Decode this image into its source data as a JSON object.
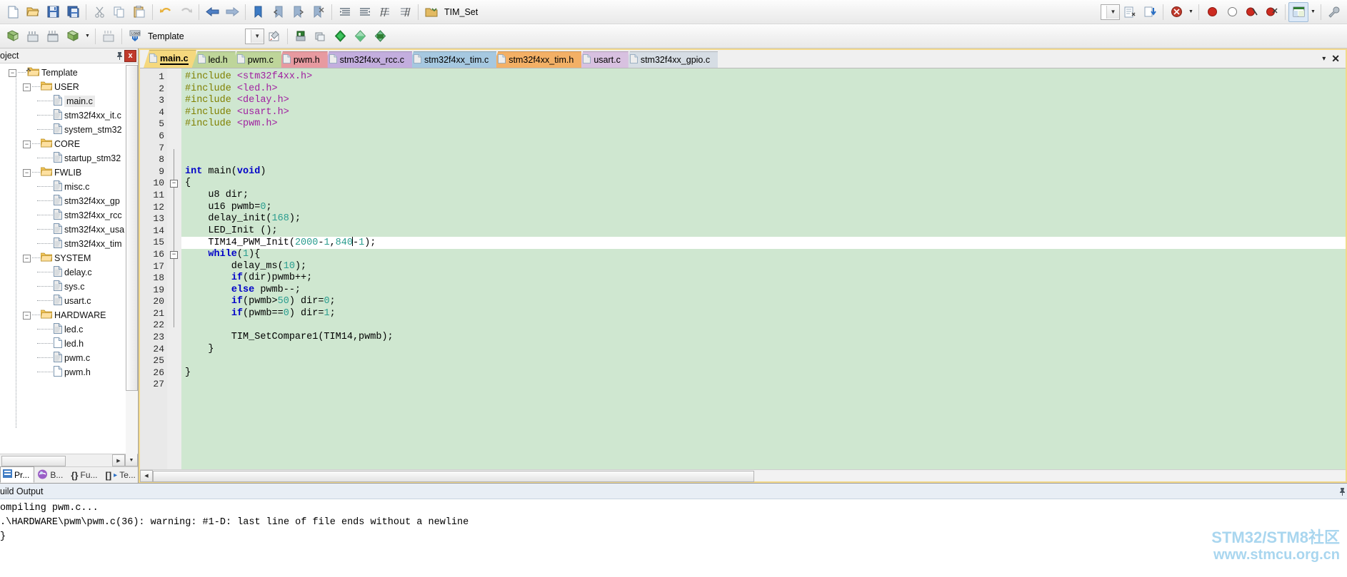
{
  "app": {
    "name": "Keil uVision",
    "target": "TIM_Set",
    "project_config": "Template"
  },
  "toolbar_main": {
    "buttons": [
      {
        "name": "new-file",
        "label": "New"
      },
      {
        "name": "open-file",
        "label": "Open"
      },
      {
        "name": "save-file",
        "label": "Save"
      },
      {
        "name": "save-all",
        "label": "Save All"
      },
      {
        "name": "cut",
        "label": "Cut"
      },
      {
        "name": "copy",
        "label": "Copy"
      },
      {
        "name": "paste",
        "label": "Paste"
      },
      {
        "name": "undo",
        "label": "Undo"
      },
      {
        "name": "redo",
        "label": "Redo"
      },
      {
        "name": "navigate-back",
        "label": "Back"
      },
      {
        "name": "navigate-forward",
        "label": "Forward"
      },
      {
        "name": "bookmark-toggle",
        "label": "Insert/Remove Bookmark"
      },
      {
        "name": "bookmark-prev",
        "label": "Go to Previous Bookmark"
      },
      {
        "name": "bookmark-next",
        "label": "Go to Next Bookmark"
      },
      {
        "name": "bookmark-clear",
        "label": "Clear All Bookmarks"
      },
      {
        "name": "indent-right",
        "label": "Indent Selected Text"
      },
      {
        "name": "indent-left",
        "label": "Unindent Selected Text"
      },
      {
        "name": "comment-block",
        "label": "Comment Selection"
      },
      {
        "name": "uncomment-block",
        "label": "Uncomment Selection"
      },
      {
        "name": "target-options",
        "label": "Target Options"
      }
    ],
    "target_value": "TIM_Set",
    "right_buttons": [
      {
        "name": "build-target",
        "label": "Build"
      },
      {
        "name": "download",
        "label": "Download"
      },
      {
        "name": "start-debug",
        "label": "Start/Stop Debug Session"
      },
      {
        "name": "insert-breakpoint",
        "label": "Insert/Remove Breakpoint"
      },
      {
        "name": "disable-breakpoint",
        "label": "Enable/Disable Breakpoint"
      },
      {
        "name": "disable-all-breakpoints",
        "label": "Disable All Breakpoints"
      },
      {
        "name": "kill-all-breakpoints",
        "label": "Kill All Breakpoints"
      },
      {
        "name": "window-layout",
        "label": "Window Layout"
      },
      {
        "name": "configuration",
        "label": "Configuration Wizard"
      }
    ]
  },
  "toolbar_build": {
    "buttons": [
      {
        "name": "translate-file",
        "label": "Translate Current File"
      },
      {
        "name": "build-target-2",
        "label": "Build Target"
      },
      {
        "name": "rebuild-all",
        "label": "Rebuild All Target Files"
      },
      {
        "name": "batch-build",
        "label": "Batch Build"
      },
      {
        "name": "stop-build",
        "label": "Stop Build"
      },
      {
        "name": "download-flash",
        "label": "Download To Flash"
      }
    ],
    "project_value": "Template",
    "right_buttons": [
      {
        "name": "manage-project-items",
        "label": "Manage Project Items"
      },
      {
        "name": "pack-installer",
        "label": "Pack Installer"
      },
      {
        "name": "run-to-main",
        "label": "Run"
      },
      {
        "name": "select-software-packs",
        "label": "Select Software Packs"
      },
      {
        "name": "manage-run-time",
        "label": "Manage Run-Time Environment"
      }
    ]
  },
  "project_panel": {
    "title": "oject",
    "pin_icon": "pin-icon",
    "close_label": "x",
    "tree": [
      {
        "label": "Template",
        "depth": 0,
        "type": "project",
        "expanded": true
      },
      {
        "label": "USER",
        "depth": 1,
        "type": "folder",
        "expanded": true
      },
      {
        "label": "main.c",
        "depth": 2,
        "type": "file-c",
        "selected": true
      },
      {
        "label": "stm32f4xx_it.c",
        "depth": 2,
        "type": "file-c"
      },
      {
        "label": "system_stm32",
        "depth": 2,
        "type": "file-c"
      },
      {
        "label": "CORE",
        "depth": 1,
        "type": "folder",
        "expanded": true
      },
      {
        "label": "startup_stm32",
        "depth": 2,
        "type": "file-c"
      },
      {
        "label": "FWLIB",
        "depth": 1,
        "type": "folder",
        "expanded": true
      },
      {
        "label": "misc.c",
        "depth": 2,
        "type": "file-c"
      },
      {
        "label": "stm32f4xx_gp",
        "depth": 2,
        "type": "file-c"
      },
      {
        "label": "stm32f4xx_rcc",
        "depth": 2,
        "type": "file-c"
      },
      {
        "label": "stm32f4xx_usa",
        "depth": 2,
        "type": "file-c"
      },
      {
        "label": "stm32f4xx_tim",
        "depth": 2,
        "type": "file-c"
      },
      {
        "label": "SYSTEM",
        "depth": 1,
        "type": "folder",
        "expanded": true
      },
      {
        "label": "delay.c",
        "depth": 2,
        "type": "file-c"
      },
      {
        "label": "sys.c",
        "depth": 2,
        "type": "file-c"
      },
      {
        "label": "usart.c",
        "depth": 2,
        "type": "file-c"
      },
      {
        "label": "HARDWARE",
        "depth": 1,
        "type": "folder",
        "expanded": true
      },
      {
        "label": "led.c",
        "depth": 2,
        "type": "file-c"
      },
      {
        "label": "led.h",
        "depth": 2,
        "type": "file-h"
      },
      {
        "label": "pwm.c",
        "depth": 2,
        "type": "file-c"
      },
      {
        "label": "pwm.h",
        "depth": 2,
        "type": "file-h"
      }
    ],
    "bottom_tabs": [
      {
        "label": "Pr...",
        "name": "tab-project",
        "active": true,
        "icon": "project-icon"
      },
      {
        "label": "B...",
        "name": "tab-books",
        "active": false,
        "icon": "books-icon"
      },
      {
        "label": "Fu...",
        "name": "tab-functions",
        "active": false,
        "icon": "braces-icon"
      },
      {
        "label": "Te...",
        "name": "tab-templates",
        "active": false,
        "icon": "templates-icon"
      }
    ]
  },
  "editor": {
    "tabs": [
      {
        "label": "main.c",
        "color": "#f5d87e",
        "active": true
      },
      {
        "label": "led.h",
        "color": "#bed59a",
        "active": false
      },
      {
        "label": "pwm.c",
        "color": "#bed59a",
        "active": false
      },
      {
        "label": "pwm.h",
        "color": "#e79aa0",
        "active": false
      },
      {
        "label": "stm32f4xx_rcc.c",
        "color": "#c3aede",
        "active": false
      },
      {
        "label": "stm32f4xx_tim.c",
        "color": "#a6c8e0",
        "active": false
      },
      {
        "label": "stm32f4xx_tim.h",
        "color": "#f3b066",
        "active": false
      },
      {
        "label": "usart.c",
        "color": "#d8c1e0",
        "active": false
      },
      {
        "label": "stm32f4xx_gpio.c",
        "color": "#d6dde4",
        "active": false
      }
    ],
    "tabbar_right": {
      "overflow": "▾",
      "close": "✕"
    },
    "code_lines": [
      {
        "n": 1,
        "tokens": [
          {
            "t": "#include ",
            "c": "pp"
          },
          {
            "t": "<stm32f4xx.h>",
            "c": "hdr"
          }
        ]
      },
      {
        "n": 2,
        "tokens": [
          {
            "t": "#include ",
            "c": "pp"
          },
          {
            "t": "<led.h>",
            "c": "hdr"
          }
        ]
      },
      {
        "n": 3,
        "tokens": [
          {
            "t": "#include ",
            "c": "pp"
          },
          {
            "t": "<delay.h>",
            "c": "hdr"
          }
        ]
      },
      {
        "n": 4,
        "tokens": [
          {
            "t": "#include ",
            "c": "pp"
          },
          {
            "t": "<usart.h>",
            "c": "hdr"
          }
        ]
      },
      {
        "n": 5,
        "tokens": [
          {
            "t": "#include ",
            "c": "pp"
          },
          {
            "t": "<pwm.h>",
            "c": "hdr"
          }
        ]
      },
      {
        "n": 6,
        "tokens": []
      },
      {
        "n": 7,
        "tokens": []
      },
      {
        "n": 8,
        "tokens": []
      },
      {
        "n": 9,
        "tokens": [
          {
            "t": "int ",
            "c": "k"
          },
          {
            "t": "main(",
            "c": "pl"
          },
          {
            "t": "void",
            "c": "k"
          },
          {
            "t": ")",
            "c": "pl"
          }
        ]
      },
      {
        "n": 10,
        "tokens": [
          {
            "t": "{",
            "c": "pl"
          }
        ],
        "fold": "minus"
      },
      {
        "n": 11,
        "tokens": [
          {
            "t": "    u8 dir;",
            "c": "pl"
          }
        ]
      },
      {
        "n": 12,
        "tokens": [
          {
            "t": "    u16 pwmb=",
            "c": "pl"
          },
          {
            "t": "0",
            "c": "num"
          },
          {
            "t": ";",
            "c": "pl"
          }
        ]
      },
      {
        "n": 13,
        "tokens": [
          {
            "t": "    delay_init(",
            "c": "pl"
          },
          {
            "t": "168",
            "c": "num"
          },
          {
            "t": ");",
            "c": "pl"
          }
        ]
      },
      {
        "n": 14,
        "tokens": [
          {
            "t": "    LED_Init ();",
            "c": "pl"
          }
        ]
      },
      {
        "n": 15,
        "tokens": [
          {
            "t": "    TIM14_PWM_Init(",
            "c": "pl"
          },
          {
            "t": "2000",
            "c": "num"
          },
          {
            "t": "-",
            "c": "pl"
          },
          {
            "t": "1",
            "c": "num"
          },
          {
            "t": ",",
            "c": "pl"
          },
          {
            "t": "840",
            "c": "num"
          },
          {
            "t": "|",
            "c": "caret"
          },
          {
            "t": "-",
            "c": "pl"
          },
          {
            "t": "1",
            "c": "num"
          },
          {
            "t": ");",
            "c": "pl"
          }
        ],
        "current": true
      },
      {
        "n": 16,
        "tokens": [
          {
            "t": "    ",
            "c": "pl"
          },
          {
            "t": "while",
            "c": "k"
          },
          {
            "t": "(",
            "c": "pl"
          },
          {
            "t": "1",
            "c": "num"
          },
          {
            "t": "){",
            "c": "pl"
          }
        ],
        "fold": "minus"
      },
      {
        "n": 17,
        "tokens": [
          {
            "t": "        delay_ms(",
            "c": "pl"
          },
          {
            "t": "10",
            "c": "num"
          },
          {
            "t": ");",
            "c": "pl"
          }
        ]
      },
      {
        "n": 18,
        "tokens": [
          {
            "t": "        ",
            "c": "pl"
          },
          {
            "t": "if",
            "c": "k"
          },
          {
            "t": "(dir)pwmb++;",
            "c": "pl"
          }
        ]
      },
      {
        "n": 19,
        "tokens": [
          {
            "t": "        ",
            "c": "pl"
          },
          {
            "t": "else",
            "c": "k"
          },
          {
            "t": " pwmb--;",
            "c": "pl"
          }
        ]
      },
      {
        "n": 20,
        "tokens": [
          {
            "t": "        ",
            "c": "pl"
          },
          {
            "t": "if",
            "c": "k"
          },
          {
            "t": "(pwmb>",
            "c": "pl"
          },
          {
            "t": "50",
            "c": "num"
          },
          {
            "t": ") dir=",
            "c": "pl"
          },
          {
            "t": "0",
            "c": "num"
          },
          {
            "t": ";",
            "c": "pl"
          }
        ]
      },
      {
        "n": 21,
        "tokens": [
          {
            "t": "        ",
            "c": "pl"
          },
          {
            "t": "if",
            "c": "k"
          },
          {
            "t": "(pwmb==",
            "c": "pl"
          },
          {
            "t": "0",
            "c": "num"
          },
          {
            "t": ") dir=",
            "c": "pl"
          },
          {
            "t": "1",
            "c": "num"
          },
          {
            "t": ";",
            "c": "pl"
          }
        ]
      },
      {
        "n": 22,
        "tokens": []
      },
      {
        "n": 23,
        "tokens": [
          {
            "t": "        TIM_SetCompare1(TIM14,pwmb);",
            "c": "pl"
          }
        ]
      },
      {
        "n": 24,
        "tokens": [
          {
            "t": "    }",
            "c": "pl"
          }
        ]
      },
      {
        "n": 25,
        "tokens": []
      },
      {
        "n": 26,
        "tokens": [
          {
            "t": "}",
            "c": "pl"
          }
        ]
      },
      {
        "n": 27,
        "tokens": []
      }
    ]
  },
  "build_output": {
    "title": "uild Output",
    "pin_icon": "pin-icon",
    "lines": [
      "ompiling pwm.c...",
      ".\\HARDWARE\\pwm\\pwm.c(36): warning:  #1-D: last line of file ends without a newline",
      "}"
    ]
  },
  "watermark": {
    "line1": "STM32/STM8社区",
    "line2": "www.stmcu.org.cn",
    "color": "#a9d6ef"
  }
}
